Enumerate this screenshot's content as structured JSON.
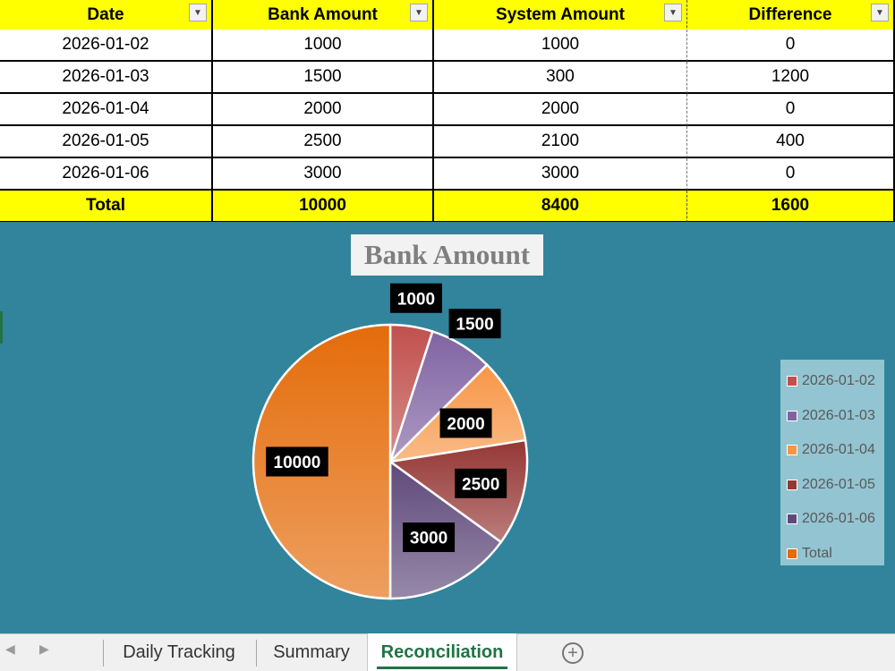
{
  "table": {
    "headers": [
      "Date",
      "Bank Amount",
      "System Amount",
      "Difference"
    ],
    "rows": [
      [
        "2026-01-02",
        "1000",
        "1000",
        "0"
      ],
      [
        "2026-01-03",
        "1500",
        "300",
        "1200"
      ],
      [
        "2026-01-04",
        "2000",
        "2000",
        "0"
      ],
      [
        "2026-01-05",
        "2500",
        "2100",
        "400"
      ],
      [
        "2026-01-06",
        "3000",
        "3000",
        "0"
      ]
    ],
    "total": [
      "Total",
      "10000",
      "8400",
      "1600"
    ],
    "filter_icon": "dropdown-arrow-icon"
  },
  "chart_data": {
    "type": "pie",
    "title": "Bank Amount",
    "categories": [
      "2026-01-02",
      "2026-01-03",
      "2026-01-04",
      "2026-01-05",
      "2026-01-06",
      "Total"
    ],
    "values": [
      1000,
      1500,
      2000,
      2500,
      3000,
      10000
    ],
    "data_labels": [
      "1000",
      "1500",
      "2000",
      "2500",
      "3000",
      "10000"
    ],
    "colors": [
      "#c0504d",
      "#8064a2",
      "#f79646",
      "#953735",
      "#5f497a",
      "#e46c0a"
    ],
    "legend_position": "right",
    "background": "#31849b"
  },
  "tabs": {
    "items": [
      "Daily Tracking",
      "Summary",
      "Reconciliation"
    ],
    "active": "Reconciliation",
    "add_icon": "plus-circle-icon"
  }
}
